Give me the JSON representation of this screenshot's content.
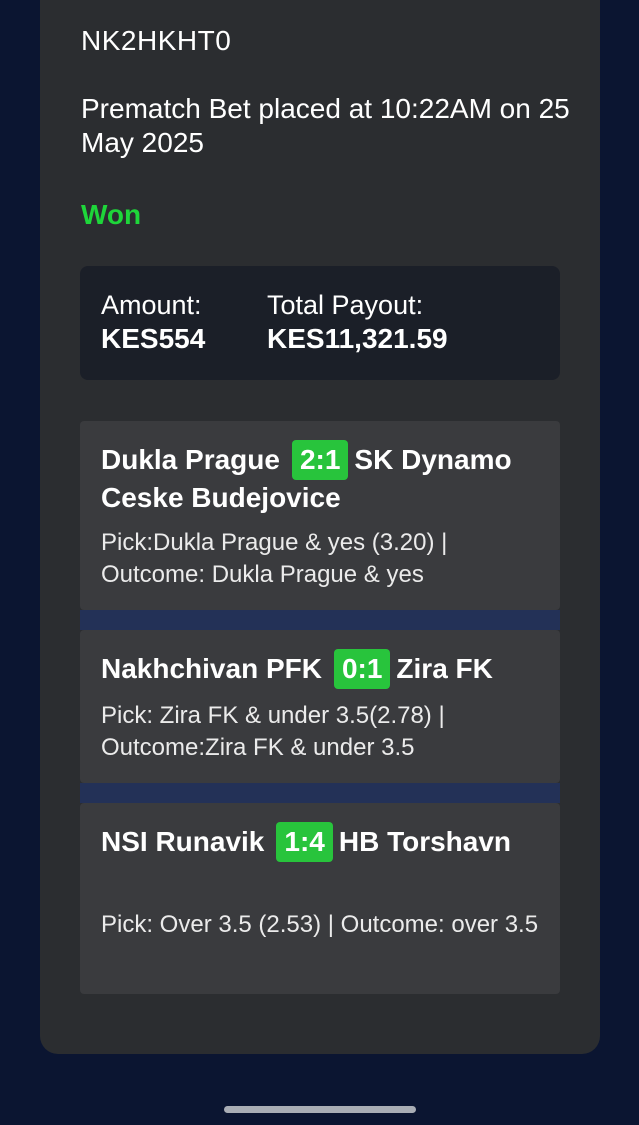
{
  "bet": {
    "id": "NK2HKHT0",
    "placed_text": "Prematch Bet placed at 10:22AM on 25 May 2025",
    "status": "Won",
    "status_color": "#1ed63a"
  },
  "summary": {
    "amount_label": "Amount:",
    "amount_value": "KES554",
    "payout_label": "Total Payout:",
    "payout_value": "KES11,321.59"
  },
  "matches": [
    {
      "home": "Dukla Prague",
      "score": "2:1",
      "away": "SK Dynamo Ceske Budejovice",
      "pick_text": "Pick:Dukla Prague & yes (3.20) | Outcome: Dukla Prague & yes"
    },
    {
      "home": "Nakhchivan PFK",
      "score": "0:1",
      "away": "Zira FK",
      "pick_text": "Pick: Zira FK & under 3.5(2.78) | Outcome:Zira FK & under 3.5"
    },
    {
      "home": "NSI Runavik",
      "score": "1:4",
      "away": "HB Torshavn",
      "pick_text": "Pick: Over 3.5 (2.53) | Outcome: over 3.5"
    }
  ],
  "colors": {
    "background": "#0b1531",
    "card": "#2b2d30",
    "score_badge": "#28c43c"
  }
}
